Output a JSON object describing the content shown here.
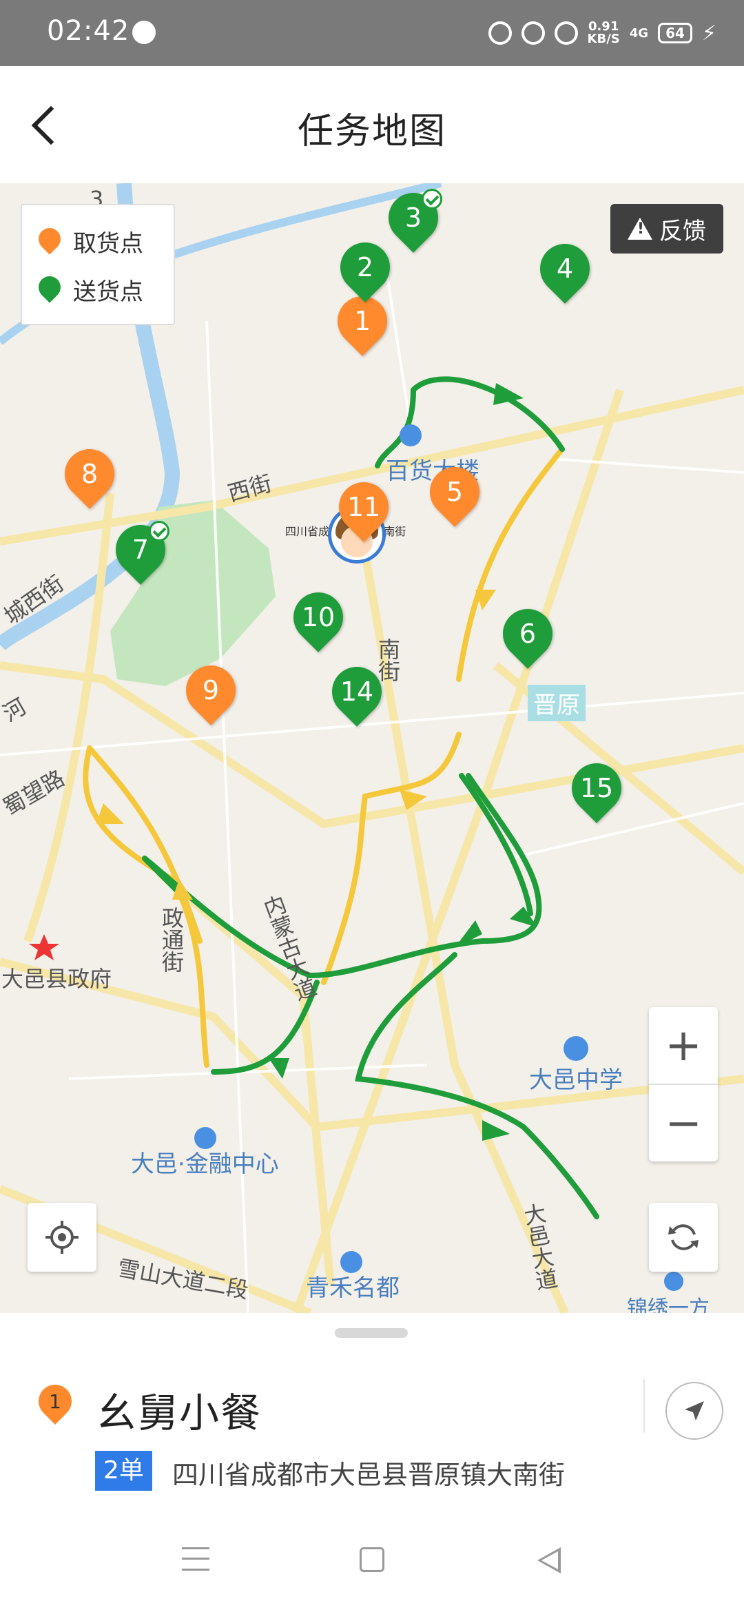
{
  "status_bar": {
    "time": "02:42",
    "net_speed": "0.91",
    "net_unit": "KB/S",
    "network": "4G",
    "battery": "64"
  },
  "header": {
    "title": "任务地图",
    "back_icon": "chevron-left-icon"
  },
  "legend": {
    "pickup_label": "取货点",
    "delivery_label": "送货点",
    "pickup_color": "#ff8a2e",
    "delivery_color": "#1f9d3a"
  },
  "feedback_label": "反馈",
  "map": {
    "labels": {
      "road_3": "3",
      "xijie": "西街",
      "chengxijie": "城西街",
      "he": "河",
      "nanjie": "南街",
      "shuwanglu": "蜀望路",
      "zhengtongjie": "政通街",
      "neimengdadao": "内蒙古大道",
      "xianzhengfu": "大邑县政府",
      "baihuodalou": "百货大楼",
      "jinyuan": "晋原",
      "dayizhongxue": "大邑中学",
      "jinrongzhongxin": "大邑·金融中心",
      "xueshandadao": "雪山大道二段",
      "qinghe": "青禾名都",
      "dayidadao": "大邑大道",
      "jinxiu": "锦绣一方",
      "location_hint": "四川省成...晋原镇大南街"
    },
    "pins": [
      {
        "num": "1",
        "type": "pickup",
        "checked": false
      },
      {
        "num": "2",
        "type": "delivery",
        "checked": false
      },
      {
        "num": "3",
        "type": "delivery",
        "checked": true
      },
      {
        "num": "4",
        "type": "delivery",
        "checked": false
      },
      {
        "num": "5",
        "type": "pickup",
        "checked": false
      },
      {
        "num": "6",
        "type": "delivery",
        "checked": false
      },
      {
        "num": "7",
        "type": "delivery",
        "checked": true
      },
      {
        "num": "8",
        "type": "pickup",
        "checked": false
      },
      {
        "num": "9",
        "type": "pickup",
        "checked": false
      },
      {
        "num": "10",
        "type": "delivery",
        "checked": false
      },
      {
        "num": "11",
        "type": "pickup",
        "checked": false
      },
      {
        "num": "14",
        "type": "delivery",
        "checked": false
      },
      {
        "num": "15",
        "type": "delivery",
        "checked": false
      }
    ],
    "zoom_in": "+",
    "zoom_out": "−"
  },
  "bottom_sheet": {
    "index": "1",
    "shop_name": "幺舅小餐",
    "order_badge": "2单",
    "address": "四川省成都市大邑县晋原镇大南街"
  }
}
